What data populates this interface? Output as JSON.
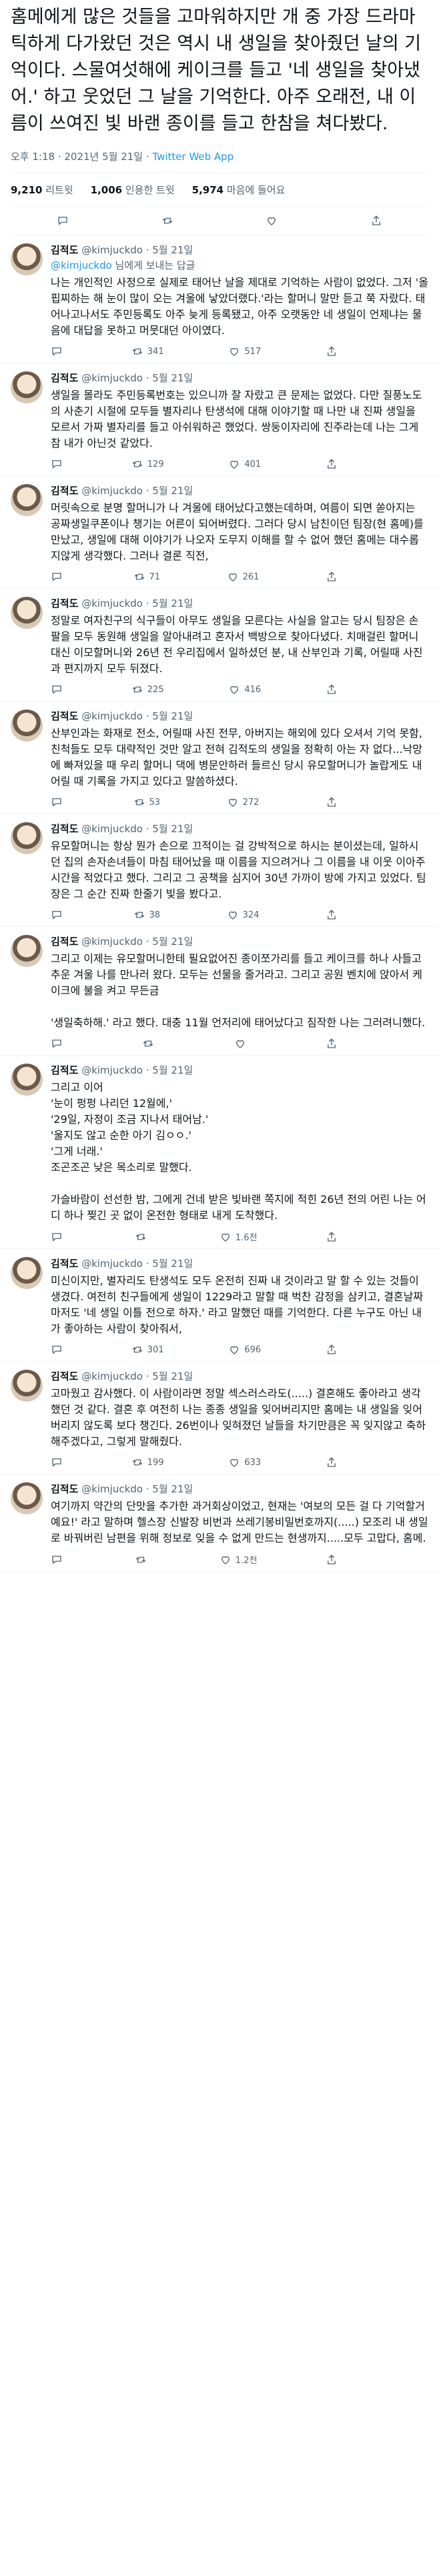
{
  "main": {
    "text": "홈메에게 많은 것들을 고마워하지만 개 중 가장 드라마틱하게 다가왔던 것은 역시 내 생일을 찾아줬던 날의 기억이다. 스물여섯해에 케이크를 들고 '네 생일을 찾아냈어.' 하고 웃었던 그 날을 기억한다. 아주 오래전, 내 이름이 쓰여진 빛 바랜 종이를 들고 한참을 쳐다봤다.",
    "time": "오후 1:18 · 2021년 5월 21일 · ",
    "app": "Twitter Web App",
    "stats": [
      {
        "num": "9,210",
        "label": "리트윗"
      },
      {
        "num": "1,006",
        "label": "인용한 트윗"
      },
      {
        "num": "5,974",
        "label": "마음에 들어요"
      }
    ]
  },
  "replies": [
    {
      "name": "김적도",
      "handle": "@kimjuckdo",
      "time": "· 5월 21일",
      "replying_link": "@kimjuckdo",
      "replying_suffix": " 님에게 보내는 답글",
      "text": "나는 개인적인 사정으로 실제로 태어난 날을 제대로 기억하는 사람이 없었다. 그저 '올핍찌하는 해 눈이 많이 오는 겨울에 낳았더랬다.'라는 할머니 말만 듣고 쭉 자랐다. 태어나고나서도 주민등록도 아주 늦게 등록됐고, 아주 오랫동안 네 생일이 언제냐는 물음에 대답을 못하고 머뭇대던 아이였다.",
      "replies": "",
      "retweets": "341",
      "likes": "517"
    },
    {
      "name": "김적도",
      "handle": "@kimjuckdo",
      "time": "· 5월 21일",
      "replying_link": "",
      "replying_suffix": "",
      "text": "생일을 몰라도 주민등록번호는 있으니까 잘 자랐고 큰 문제는 없었다. 다만 질풍노도의 사춘기 시절에 모두들 별자리나 탄생석에 대해 이야기할 때 나만 내 진짜 생일을 모르서 가짜 별자리를 들고 아쉬워하곤 했었다. 쌍둥이자리에 진주라는데 나는 그게 참 내가 아닌것 같았다.",
      "replies": "",
      "retweets": "129",
      "likes": "401"
    },
    {
      "name": "김적도",
      "handle": "@kimjuckdo",
      "time": "· 5월 21일",
      "replying_link": "",
      "replying_suffix": "",
      "text": "머릿속으로 분명 할머니가 나 겨울에 태어났다고했는데하며, 여름이 되면 쏟아지는 공짜생일쿠폰이나 챙기는 어른이 되어버렸다. 그러다 당시 남친이던 팀장(현 홈메)를 만났고, 생일에 대해 이야기가 나오자 도무지 이해를 할 수 없어 했던 홈메는 대수롭지않게 생각했다. 그러나 결론 직전,",
      "replies": "",
      "retweets": "71",
      "likes": "261"
    },
    {
      "name": "김적도",
      "handle": "@kimjuckdo",
      "time": "· 5월 21일",
      "replying_link": "",
      "replying_suffix": "",
      "text": "정말로 여자친구의 식구들이 아무도 생일을 모른다는 사실을 알고는 당시 팀장은 손팔을 모두 동원해 생일을 알아내려고 혼자서 백방으로 찾아다녔다. 치매걸린 할머니 대신 이모할머니와 26년 전 우리집에서 일하셨던 분, 내 산부인과 기록, 어릴때 사진과 편지까지 모두 뒤졌다.",
      "replies": "",
      "retweets": "225",
      "likes": "416"
    },
    {
      "name": "김적도",
      "handle": "@kimjuckdo",
      "time": "· 5월 21일",
      "replying_link": "",
      "replying_suffix": "",
      "text": "산부인과는 화재로 전소, 어릴때 사진 전무, 아버지는 해외에 있다 오셔서 기억 못함, 친척들도 모두 대략적인 것만 알고 전혀 김적도의 생일을 정확히 아는 자 없다...낙망에 빠져있을 때 우리 할머니 댁에 병문안하러 들르신 당시 유모할머니가 놀랍게도 내 어릴 때 기록을 가지고 있다고 말씀하셨다.",
      "replies": "",
      "retweets": "53",
      "likes": "272"
    },
    {
      "name": "김적도",
      "handle": "@kimjuckdo",
      "time": "· 5월 21일",
      "replying_link": "",
      "replying_suffix": "",
      "text": "유모할머니는 항상 뭔가 손으로 끄적이는 걸 강박적으로 하시는 분이셨는데, 일하시던 집의 손자손녀들이 마침 태어났을 때 이름을 지으려거나 그 이름을 내 이웃 이아주 시간을 적었다고 했다. 그리고 그 공책을 심지어 30년 가까이 방에 가지고 있었다. 팀장은 그 순간 진짜 한줄기 빛을 봤다고.",
      "replies": "",
      "retweets": "38",
      "likes": "324"
    },
    {
      "name": "김적도",
      "handle": "@kimjuckdo",
      "time": "· 5월 21일",
      "replying_link": "",
      "replying_suffix": "",
      "text": "그리고 이제는 유모할머니한테 필요없어진 종이쪼가리를 들고 케이크를 하나 사들고 추운 겨울 나를 만나러 왔다. 모두는 선물을 줄거라고. 그리고 공원 벤치에 앉아서 케이크에 불을 켜고 무든금\n\n'생일축하해.' 라고 했다. 대충 11월 언저리에 태어났다고 짐작한 나는 그러려니했다.",
      "replies": "",
      "retweets": "",
      "likes": ""
    },
    {
      "name": "김적도",
      "handle": "@kimjuckdo",
      "time": "· 5월 21일",
      "replying_link": "",
      "replying_suffix": "",
      "text": "그리고 이어\n'눈이 펑펑 나리던 12월에,'\n'29일, 자정이 조금 지나서 태어남.'\n'울지도 않고 순한 아기 김ㅇㅇ.'\n'그게 너래.'\n조곤조곤 낮은 목소리로 말했다.\n\n가슬바람이 선선한 밤, 그에게 건네 받은 빛바랜 쪽지에 적힌 26년 전의 어린 나는 어디 하나 찢긴 곳 없이 온전한 형태로 내게 도착했다.",
      "replies": "",
      "retweets": "",
      "likes": "1.6천"
    },
    {
      "name": "김적도",
      "handle": "@kimjuckdo",
      "time": "· 5월 21일",
      "replying_link": "",
      "replying_suffix": "",
      "text": "미신이지만, 별자리도 탄생석도 모두 온전히 진짜 내 것이라고 말 할 수 있는 것들이 생겼다. 여전히 친구들에게 생일이 1229라고 말할 때 벅찬 감정을 삼키고, 결혼날짜마저도 '네 생일 이틀 전으로 하자.' 라고 말했던 때를 기억한다. 다른 누구도 아닌 내가 좋아하는 사람이 찾아줘서,",
      "replies": "",
      "retweets": "301",
      "likes": "696"
    },
    {
      "name": "김적도",
      "handle": "@kimjuckdo",
      "time": "· 5월 21일",
      "replying_link": "",
      "replying_suffix": "",
      "text": "고마웠고 감사했다. 이 사람이라면 정말 섹스러스라도(.....) 결혼해도 좋아라고 생각했던 것 같다. 결혼 후 여전히 나는 종종 생일을 잊어버리지만 홈메는 내 생일을 잊어버리지 않도록 보다 챙긴다. 26번이나 잊혀졌던 날들을 차기만큼은 꼭 잊지않고 축하해주겠다고, 그렇게 말해줬다.",
      "replies": "",
      "retweets": "199",
      "likes": "633"
    },
    {
      "name": "김적도",
      "handle": "@kimjuckdo",
      "time": "· 5월 21일",
      "replying_link": "",
      "replying_suffix": "",
      "text": "여기까지 약간의 단맛을 추가한 과거회상이었고, 현재는 '여보의 모든 걸 다 기억할거예요!' 라고 말하며 헬스장 신발장 비번과 쓰레기봉비밀번호까지(.....) 모조리 내 생일로 바꿔버린 남편을 위해 정보로 잊을 수 없게 만드는 현생까지.....모두 고맙다, 홈메.",
      "replies": "",
      "retweets": "",
      "likes": "1.2천"
    }
  ]
}
